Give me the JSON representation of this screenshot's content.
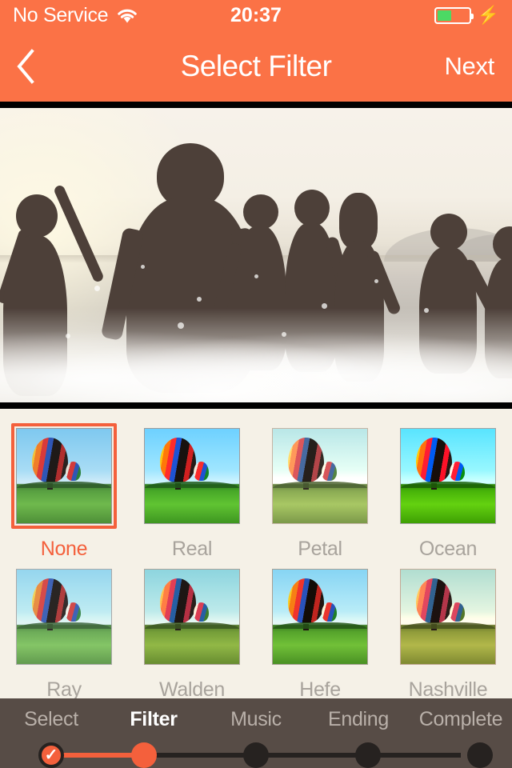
{
  "status_bar": {
    "carrier": "No Service",
    "wifi_icon": "wifi-icon",
    "time": "20:37",
    "battery_icon": "battery-icon",
    "battery_percent": 45,
    "charging_icon": "lightning-bolt-icon"
  },
  "nav_bar": {
    "back_icon": "chevron-left-icon",
    "title": "Select Filter",
    "next_label": "Next"
  },
  "preview": {
    "name": "video-preview",
    "description": "Backlit beach scene with friends running through surf"
  },
  "filters": {
    "selected": "None",
    "items": [
      {
        "label": "None",
        "class": "f-none",
        "selected": true
      },
      {
        "label": "Real",
        "class": "f-real",
        "selected": false
      },
      {
        "label": "Petal",
        "class": "f-petal",
        "selected": false
      },
      {
        "label": "Ocean",
        "class": "f-ocean",
        "selected": false
      },
      {
        "label": "Ray",
        "class": "f-ray",
        "selected": false
      },
      {
        "label": "Walden",
        "class": "f-walden",
        "selected": false
      },
      {
        "label": "Hefe",
        "class": "f-hefe",
        "selected": false
      },
      {
        "label": "Nashville",
        "class": "f-nashville",
        "selected": false
      }
    ]
  },
  "steps": {
    "current": "Filter",
    "items": [
      {
        "label": "Select",
        "state": "done"
      },
      {
        "label": "Filter",
        "state": "current"
      },
      {
        "label": "Music",
        "state": "pending"
      },
      {
        "label": "Ending",
        "state": "pending"
      },
      {
        "label": "Complete",
        "state": "pending"
      }
    ],
    "check_glyph": "✓"
  },
  "colors": {
    "accent": "#FB7246",
    "accent_dark": "#F4603C",
    "panel_bg": "#F5F1E7",
    "step_bar_bg": "#574C46",
    "step_inactive": "#262220",
    "label_muted": "#A8A39C",
    "battery_green": "#4CD964"
  }
}
